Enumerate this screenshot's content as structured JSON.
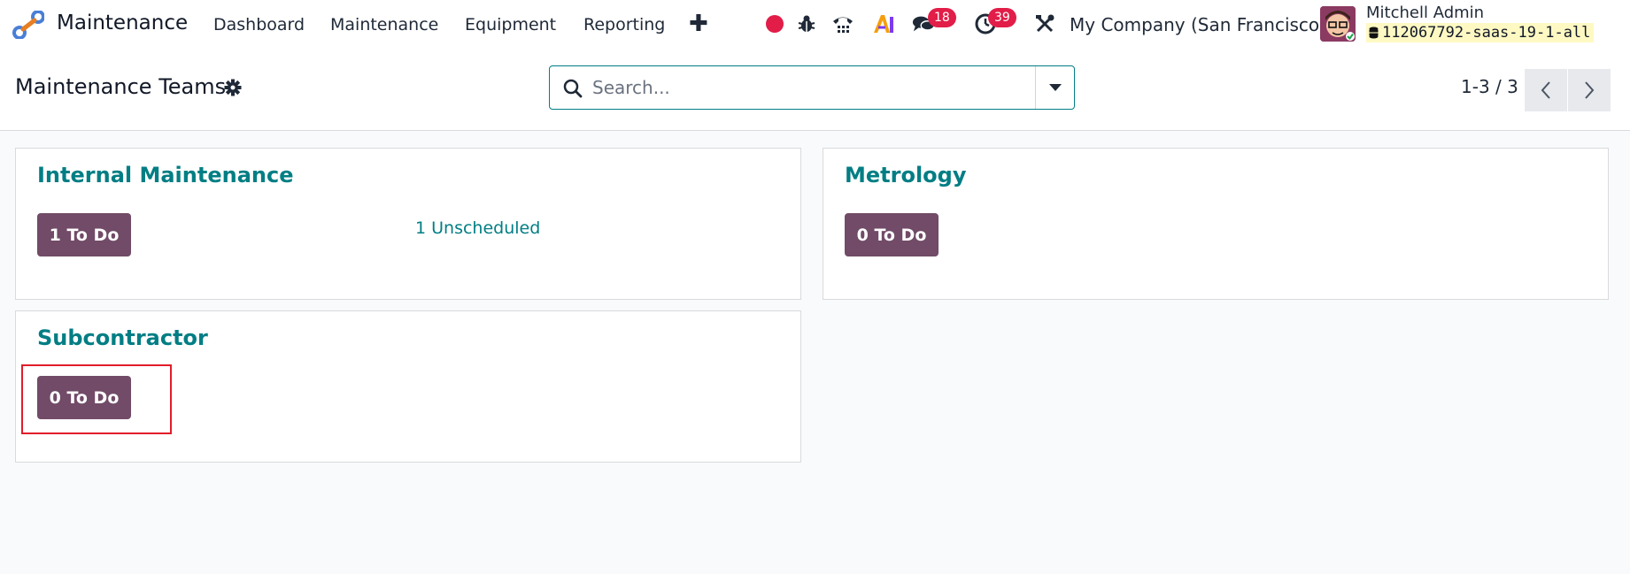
{
  "navbar": {
    "app_name": "Maintenance",
    "menus": [
      "Dashboard",
      "Maintenance",
      "Equipment",
      "Reporting"
    ],
    "messages_badge": "18",
    "activities_badge": "39",
    "company": "My Company (San Francisco)",
    "user_name": "Mitchell Admin",
    "database": "112067792-saas-19-1-all"
  },
  "control": {
    "title": "Maintenance Teams",
    "search_placeholder": "Search...",
    "pager": "1-3 / 3"
  },
  "teams": [
    {
      "name": "Internal Maintenance",
      "todo": "1 To Do",
      "unscheduled": "1 Unscheduled"
    },
    {
      "name": "Metrology",
      "todo": "0 To Do"
    },
    {
      "name": "Subcontractor",
      "todo": "0 To Do"
    }
  ],
  "colors": {
    "brand": "#714b67",
    "accent": "#017e84",
    "badge": "#e11d48"
  }
}
